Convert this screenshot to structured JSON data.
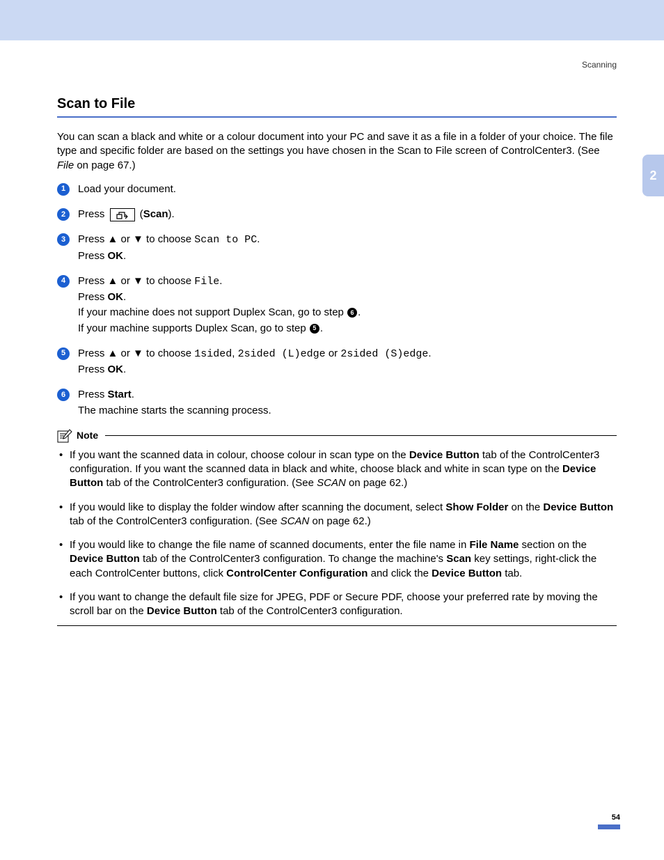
{
  "running_head": "Scanning",
  "chapter_tab": "2",
  "title": "Scan to File",
  "intro": {
    "line1": "You can scan a black and white or a colour document into your PC and save it as a file in a folder of your choice. The file type and specific folder are based on the settings you have chosen in the Scan to File screen of ControlCenter3. (See ",
    "file_ref": "File",
    "line1_end": " on page 67.)"
  },
  "steps": {
    "s1": "Load your document.",
    "s2_a": "Press ",
    "s2_b": " (",
    "s2_scan": "Scan",
    "s2_c": ").",
    "s3_a": "Press ▲ or ▼ to choose ",
    "s3_mono": "Scan to PC",
    "s3_b": ".",
    "press_ok": "Press ",
    "ok": "OK",
    "period": ".",
    "s4_a": "Press ▲ or ▼ to choose ",
    "s4_mono": "File",
    "s4_b": ".",
    "s4_c": "If your machine does not support Duplex Scan, go to step ",
    "s4_c_end": ".",
    "s4_d": "If your machine supports Duplex Scan, go to step ",
    "s4_d_end": ".",
    "s5_a": "Press ▲ or ▼ to choose ",
    "s5_m1": "1sided",
    "s5_comma": ", ",
    "s5_m2": "2sided (L)edge",
    "s5_or": " or ",
    "s5_m3": "2sided (S)edge",
    "s5_end": ".",
    "s6_a": "Press ",
    "s6_start": "Start",
    "s6_b": ".",
    "s6_c": "The machine starts the scanning process."
  },
  "note_label": "Note",
  "notes": {
    "n1_a": "If you want the scanned data in colour, choose colour in scan type on the ",
    "devbtn": "Device Button",
    "n1_b": " tab of the ControlCenter3 configuration. If you want the scanned data in black and white, choose black and white in scan type on the ",
    "n1_c": " tab of the ControlCenter3 configuration. (See ",
    "scan_it": "SCAN",
    "n1_d": " on page 62.)",
    "n2_a": "If you would like to display the folder window after scanning the document, select ",
    "show_folder": "Show Folder",
    "n2_b": " on the ",
    "n2_c": " tab of the ControlCenter3 configuration. (See ",
    "n2_d": " on page 62.)",
    "n3_a": "If you would like to change the file name of scanned documents, enter the file name in ",
    "file_name": "File Name",
    "n3_b": " section on the ",
    "n3_c": " tab of the ControlCenter3 configuration. To change the machine's ",
    "scan_b": "Scan",
    "n3_d": " key settings, right-click the each ControlCenter buttons, click ",
    "cc_conf": "ControlCenter Configuration",
    "n3_e": " and click the ",
    "n3_f": " tab.",
    "n4_a": "If you want to change the default file size for JPEG, PDF or Secure PDF, choose your preferred rate by moving the scroll bar on the ",
    "n4_b": " tab of the ControlCenter3 configuration."
  },
  "page_number": "54"
}
